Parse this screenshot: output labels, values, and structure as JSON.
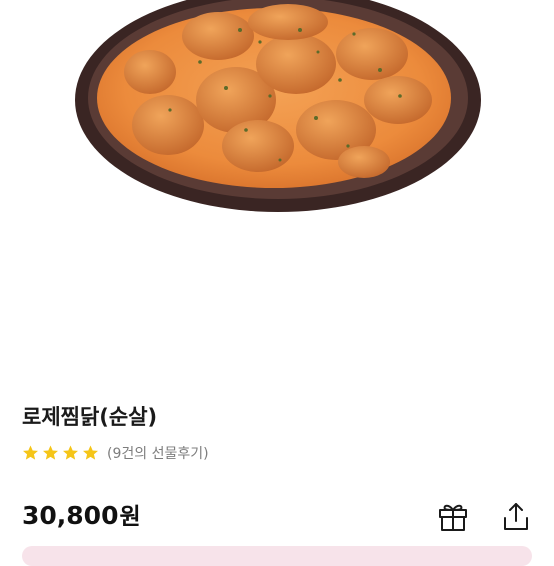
{
  "product": {
    "image_alt": "로제찜닭(순살)",
    "title": "로제찜닭(순살)",
    "rating_stars": 4,
    "review_text": "(9건의 선물후기)",
    "price": "30,800",
    "currency": "원"
  },
  "actions": {
    "gift_icon": "gift-icon",
    "share_icon": "share-icon"
  },
  "colors": {
    "star": "#f5c518",
    "text": "#1a1a1a",
    "muted": "#7d7d7d",
    "bottom_bar": "#f7e3ea"
  }
}
